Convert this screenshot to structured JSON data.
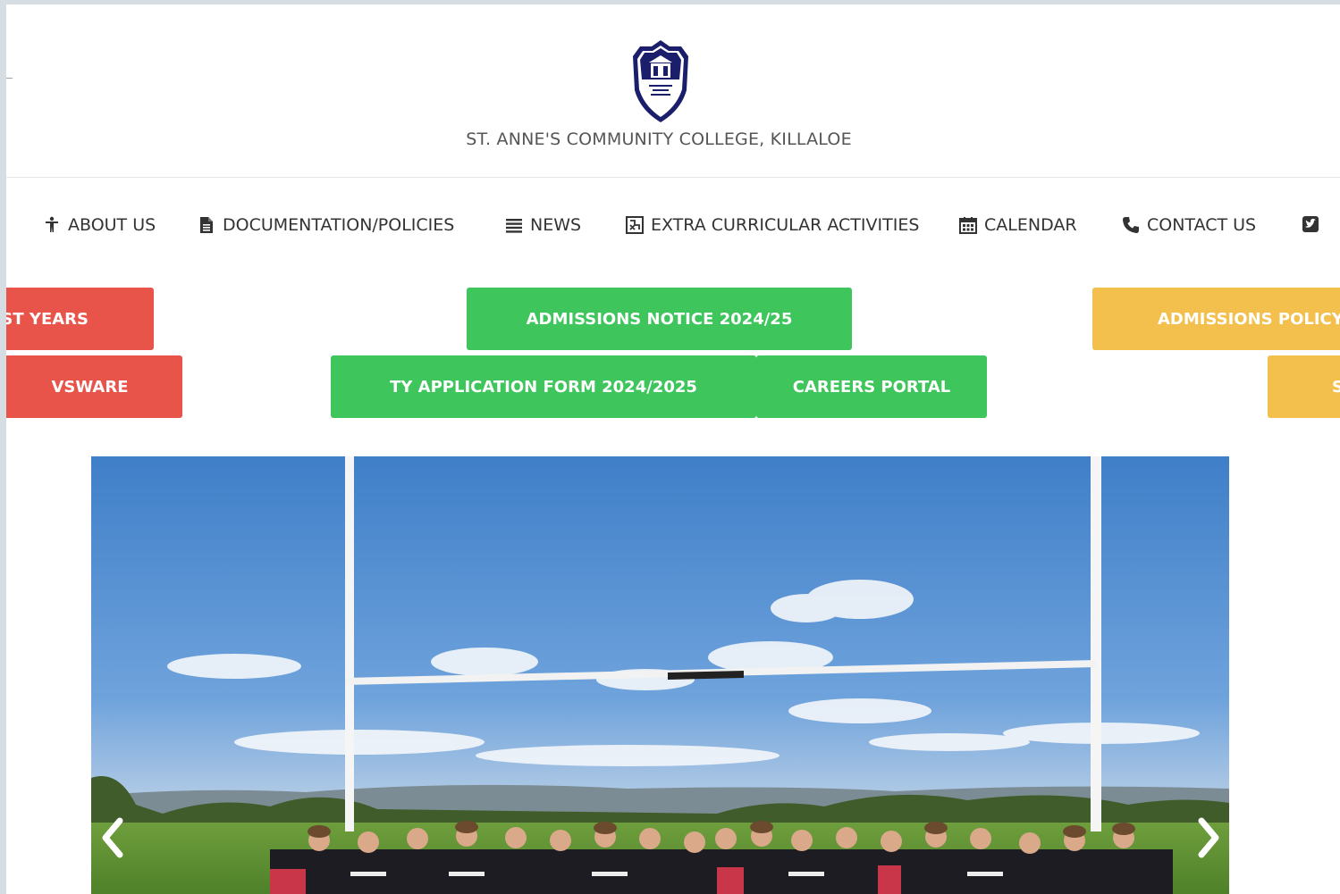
{
  "site": {
    "title": "ST. ANNE'S COMMUNITY COLLEGE, KILLALOE"
  },
  "nav": {
    "items": [
      {
        "label": "ABOUT US",
        "icon": "person-icon"
      },
      {
        "label": "DOCUMENTATION/POLICIES",
        "icon": "document-icon"
      },
      {
        "label": "NEWS",
        "icon": "list-icon"
      },
      {
        "label": "EXTRA CURRICULAR ACTIVITIES",
        "icon": "activities-icon"
      },
      {
        "label": "CALENDAR",
        "icon": "calendar-icon"
      },
      {
        "label": "CONTACT US",
        "icon": "phone-icon"
      },
      {
        "label": "",
        "icon": "twitter-icon"
      }
    ]
  },
  "quick_links": {
    "first_years": "ST YEARS",
    "admissions_notice": "ADMISSIONS NOTICE 2024/25",
    "admissions_policy": "ADMISSIONS POLICY",
    "vsware": "VSWARE",
    "ty_application": "TY APPLICATION FORM 2024/2025",
    "careers_portal": "CAREERS PORTAL",
    "right_partial": "S"
  },
  "slider": {
    "image": "rugby-team-photo",
    "prev_icon": "chevron-left-icon",
    "next_icon": "chevron-right-icon"
  },
  "colors": {
    "red": "#e9544a",
    "green": "#3ec55b",
    "yellow": "#f3c04e",
    "navy": "#1b1f6b"
  }
}
